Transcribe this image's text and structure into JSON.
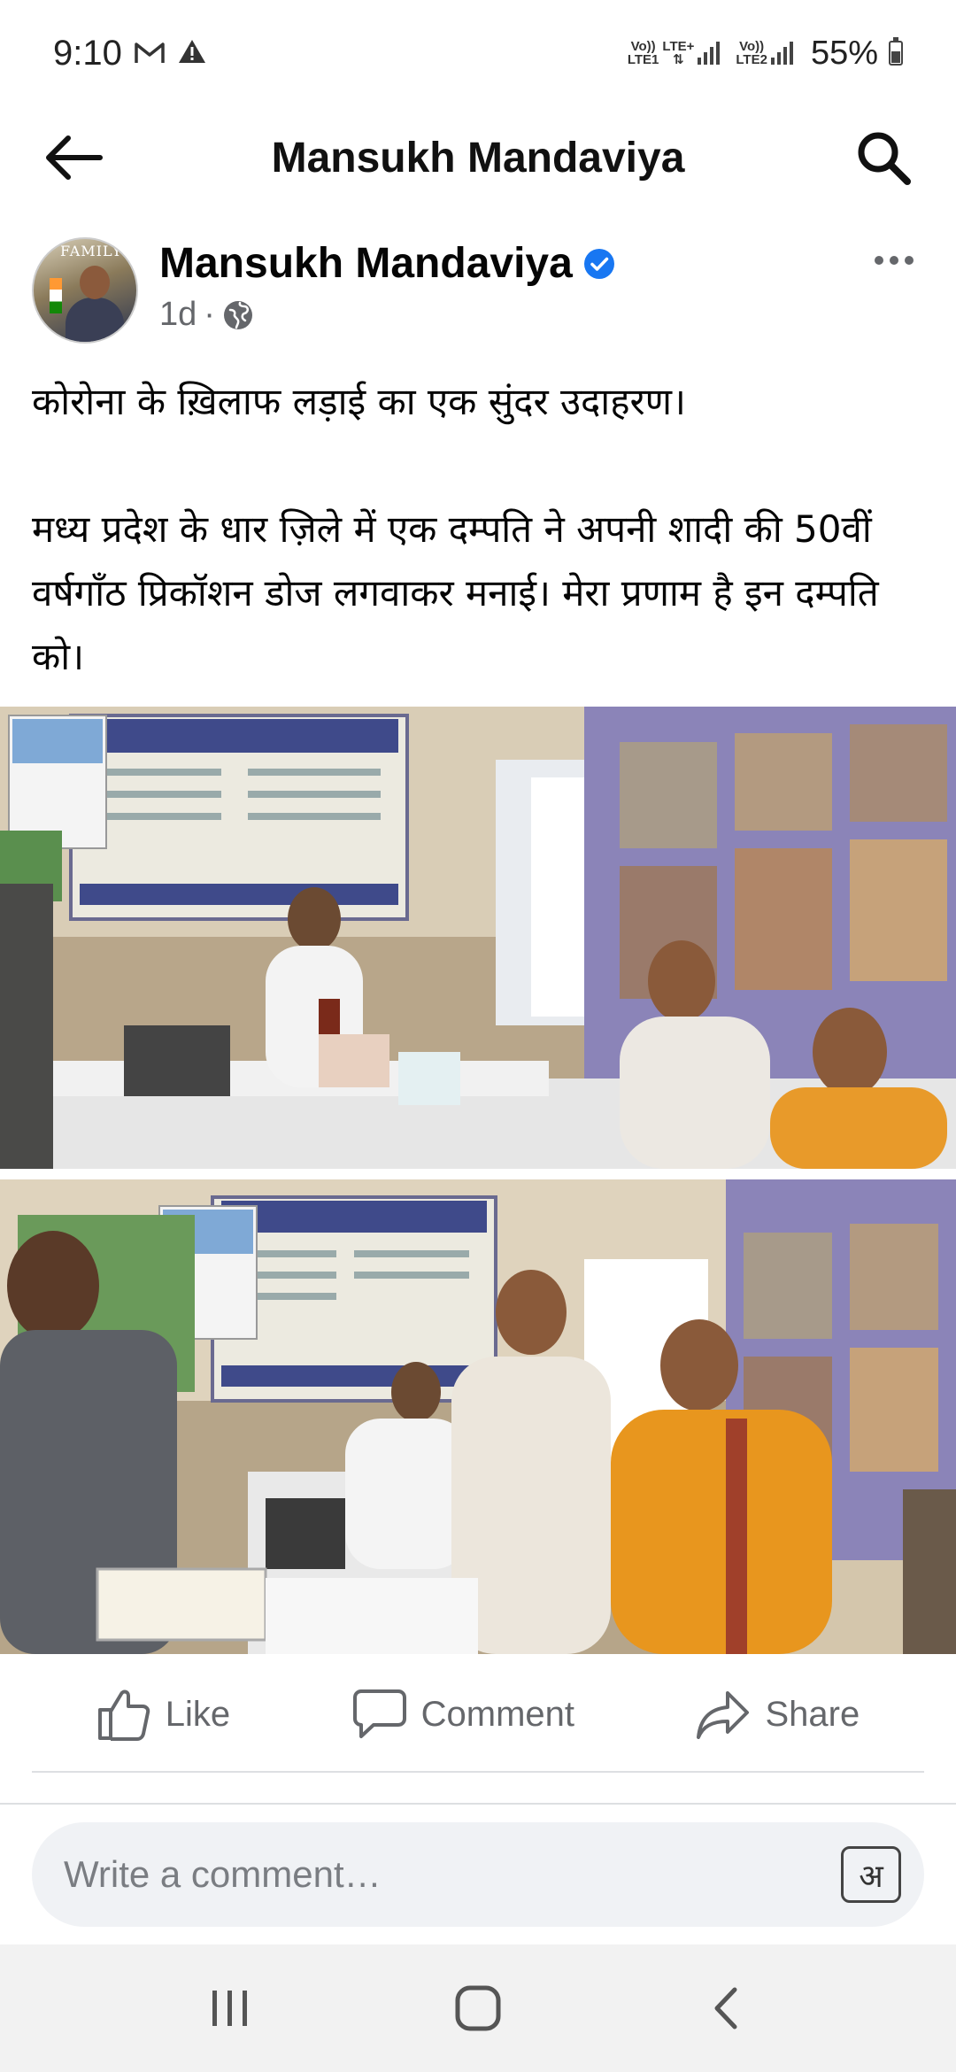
{
  "status_bar": {
    "time": "9:10",
    "notif_icons": [
      "gmail-icon",
      "warning-icon"
    ],
    "sim1_top": "Vo))",
    "sim1_bottom": "LTE1",
    "sim1_net": "LTE+",
    "sim2_top": "Vo))",
    "sim2_bottom": "LTE2",
    "battery": "55%",
    "battery_level": 0.55
  },
  "app_bar": {
    "title": "Mansukh Mandaviya",
    "back_icon": "arrow-left-icon",
    "search_icon": "search-icon"
  },
  "post": {
    "author": "Mansukh Mandaviya",
    "verified": true,
    "avatar_text": "FAMILY",
    "time": "1d",
    "separator": "·",
    "audience_icon": "globe-icon",
    "paragraphs": [
      "कोरोना के ख़िलाफ लड़ाई का एक सुंदर उदाहरण।",
      "मध्य प्रदेश के धार ज़िले में एक दम्पति ने अपनी शादी की 50वीं वर्षगाँठ प्रिकॉशन डोज लगवाकर मनाई। मेरा प्रणाम है इन दम्पति को।"
    ]
  },
  "actions": {
    "like": "Like",
    "comment": "Comment",
    "share": "Share"
  },
  "comment_box": {
    "placeholder": "Write a comment…",
    "lang_key": "अ"
  },
  "colors": {
    "verified_blue": "#1877f2",
    "meta_gray": "#65676b",
    "input_bg": "#f0f2f5"
  }
}
